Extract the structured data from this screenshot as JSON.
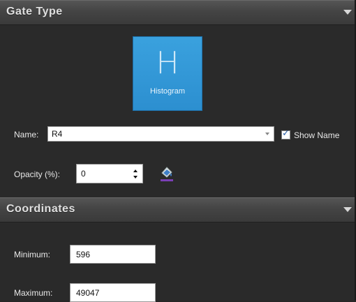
{
  "gate_type_section": {
    "title": "Gate Type"
  },
  "gate": {
    "glyph": "H",
    "caption": "Histogram"
  },
  "name_row": {
    "label": "Name:",
    "value": "R4",
    "show_name_label": "Show Name",
    "show_name_checked": true
  },
  "opacity_row": {
    "label": "Opacity (%):",
    "value": "0"
  },
  "coordinates_section": {
    "title": "Coordinates"
  },
  "coordinates": {
    "minimum_label": "Minimum:",
    "minimum_value": "596",
    "maximum_label": "Maximum:",
    "maximum_value": "49047"
  },
  "colors": {
    "tile_blue": "#2c8fd0",
    "panel_bg": "#2a2a2a",
    "header_gray": "#444444"
  },
  "icons": [
    "collapse-arrow-icon",
    "dropdown-arrow-icon",
    "checkmark-icon",
    "spin-up-icon",
    "spin-down-icon",
    "fill-color-icon"
  ]
}
